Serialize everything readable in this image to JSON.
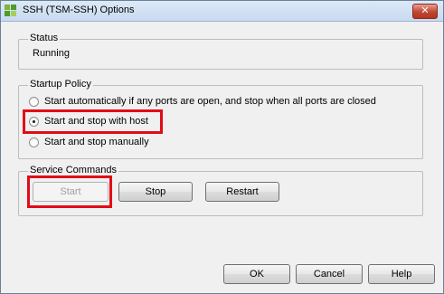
{
  "window": {
    "title": "SSH (TSM-SSH) Options",
    "close_label": "✕"
  },
  "status": {
    "group_label": "Status",
    "value": "Running"
  },
  "startup_policy": {
    "group_label": "Startup Policy",
    "options": [
      {
        "label": "Start automatically if any ports are open, and stop when all ports are closed",
        "selected": false
      },
      {
        "label": "Start and stop with host",
        "selected": true
      },
      {
        "label": "Start and stop manually",
        "selected": false
      }
    ]
  },
  "service_commands": {
    "group_label": "Service Commands",
    "start_label": "Start",
    "stop_label": "Stop",
    "restart_label": "Restart"
  },
  "footer": {
    "ok_label": "OK",
    "cancel_label": "Cancel",
    "help_label": "Help"
  },
  "colors": {
    "annotation_highlight": "#e30b17"
  }
}
